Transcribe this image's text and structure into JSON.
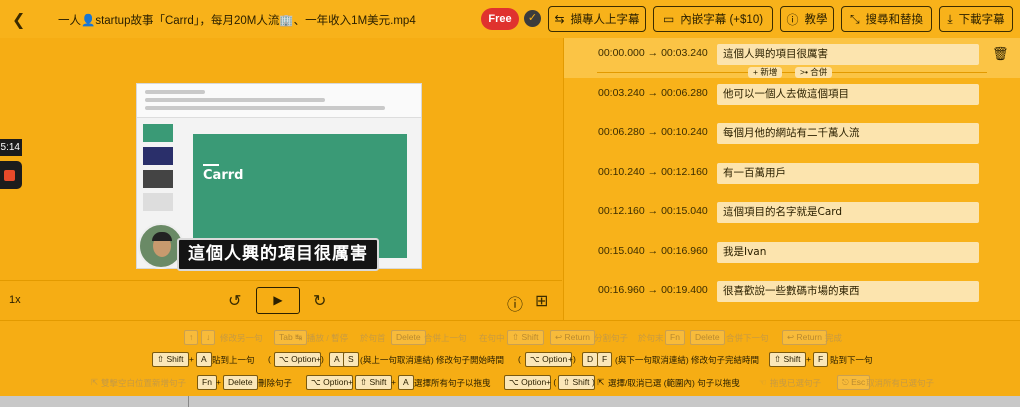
{
  "topbar": {
    "filename": "一人👤startup故事「Carrd」，每月20M人流🏢、一年收入1M美元.mp4",
    "free_badge": "Free",
    "buttons": [
      {
        "label": "擷專人上字幕",
        "icon": "translate-icon"
      },
      {
        "label": "內嵌字幕 (+$10)",
        "icon": "subtitle-icon"
      },
      {
        "label": "教學",
        "icon": "info-icon"
      },
      {
        "label": "搜尋和替換",
        "icon": "replace-icon"
      },
      {
        "label": "下載字幕",
        "icon": "download-icon"
      }
    ]
  },
  "player": {
    "timestamp": "5:14",
    "slide_title": "Carrd",
    "current_subtitle": "這個人興的項目很厲害",
    "speed": "1x"
  },
  "subtitles": [
    {
      "start": "00:00.000",
      "end": "00:03.240",
      "text": "這個人興的項目很厲害"
    },
    {
      "start": "00:03.240",
      "end": "00:06.280",
      "text": "他可以一個人去做這個項目"
    },
    {
      "start": "00:06.280",
      "end": "00:10.240",
      "text": "每個月他的網站有二千萬人流"
    },
    {
      "start": "00:10.240",
      "end": "00:12.160",
      "text": "有一百萬用戶"
    },
    {
      "start": "00:12.160",
      "end": "00:15.040",
      "text": "這個項目的名字就是Card"
    },
    {
      "start": "00:15.040",
      "end": "00:16.960",
      "text": "我是Ivan"
    },
    {
      "start": "00:16.960",
      "end": "00:19.400",
      "text": "很喜歡說一些數碼市場的東西"
    }
  ],
  "arrow": "→",
  "row_actions": {
    "add": "+ 新增",
    "merge": ">• 合併"
  },
  "shortcuts": {
    "row1": [
      {
        "keys": [
          "↑",
          "↓"
        ],
        "label": "修改另一句"
      },
      {
        "keys": [
          "Tab ↹"
        ],
        "label": "播放 / 暫停"
      },
      {
        "prefix": "於句首",
        "keys": [
          "Delete"
        ],
        "label": "合併上一句"
      },
      {
        "prefix": "在句中",
        "keys": [
          "⇧ Shift",
          "↩ Return"
        ],
        "label": "分割句子"
      },
      {
        "prefix": "於句末",
        "keys": [
          "Fn",
          "Delete"
        ],
        "label": "合併下一句"
      },
      {
        "keys": [
          "↩ Return"
        ],
        "label": "完成"
      }
    ],
    "row2": [
      {
        "keys": [
          "⇧ Shift",
          "A"
        ],
        "label": "貼到上一句"
      },
      {
        "keys": [
          "⌥ Option",
          "A",
          "S"
        ],
        "label": "(與上一句取消連結) 修改句子開始時間"
      },
      {
        "keys": [
          "⌥ Option",
          "D",
          "F"
        ],
        "label": "(與下一句取消連結) 修改句子完結時間"
      },
      {
        "keys": [
          "⇧ Shift",
          "F"
        ],
        "label": "貼到下一句"
      }
    ],
    "row3": [
      {
        "label": "雙擊空白位置新增句子"
      },
      {
        "keys": [
          "Fn",
          "Delete"
        ],
        "label": "刪除句子"
      },
      {
        "keys": [
          "⌥ Option",
          "⇧ Shift",
          "A"
        ],
        "label": "選擇所有句子以拖曳"
      },
      {
        "keys": [
          "⌥ Option",
          "⇧ Shift"
        ],
        "label": "選擇/取消已選 (範圍內) 句子以拖曳"
      },
      {
        "label": "拖曳已選句子"
      },
      {
        "keys": [
          "⎋ Esc"
        ],
        "label": "取消所有已選句子"
      }
    ]
  }
}
